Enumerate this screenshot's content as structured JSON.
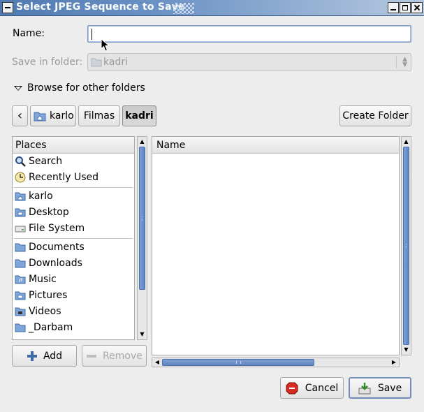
{
  "window": {
    "title": "Select JPEG Sequence to Save"
  },
  "form": {
    "name_label": "Name:",
    "name_value": "",
    "save_in_label": "Save in folder:",
    "save_in_value": "kadri",
    "browse_label": "Browse for other folders"
  },
  "path_bar": {
    "back_arrow": "‹",
    "segments": [
      "karlo",
      "Filmas",
      "kadri"
    ],
    "active_segment": "kadri",
    "create_folder_label": "Create Folder"
  },
  "places": {
    "header": "Places",
    "items": [
      {
        "label": "Search",
        "icon": "search-icon"
      },
      {
        "label": "Recently Used",
        "icon": "recent-icon"
      },
      {
        "label": "karlo",
        "icon": "home-folder-icon"
      },
      {
        "label": "Desktop",
        "icon": "desktop-folder-icon"
      },
      {
        "label": "File System",
        "icon": "drive-icon"
      },
      {
        "label": "Documents",
        "icon": "folder-icon"
      },
      {
        "label": "Downloads",
        "icon": "folder-icon"
      },
      {
        "label": "Music",
        "icon": "music-folder-icon"
      },
      {
        "label": "Pictures",
        "icon": "pictures-folder-icon"
      },
      {
        "label": "Videos",
        "icon": "videos-folder-icon"
      },
      {
        "label": "_Darbam",
        "icon": "folder-icon"
      }
    ],
    "add_label": "Add",
    "remove_label": "Remove"
  },
  "files": {
    "header": "Name",
    "rows": []
  },
  "actions": {
    "cancel_label": "Cancel",
    "save_label": "Save"
  },
  "colors": {
    "title_bar": "#5e87be",
    "selection_accent": "#6f8dbb",
    "scroll_thumb": "#6a8fc9"
  }
}
